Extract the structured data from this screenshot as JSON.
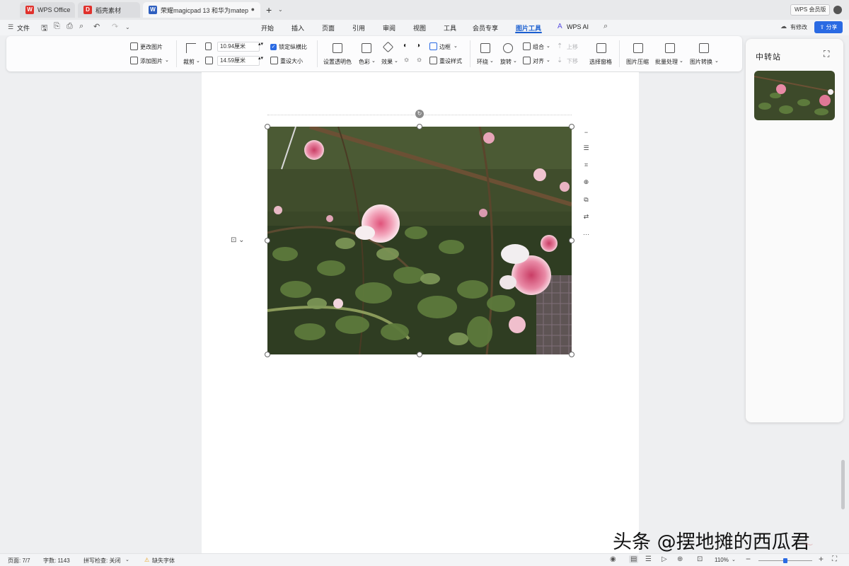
{
  "tabs": [
    {
      "label": "WPS Office",
      "icon": "wps-logo-icon",
      "color": "#e0312c"
    },
    {
      "label": "稻壳素材",
      "icon": "daoke-logo-icon",
      "color": "#e0312c"
    },
    {
      "label": "荣耀magicpad 13 和华为matep",
      "icon": "word-doc-icon",
      "color": "#2f5fbf",
      "active": true
    }
  ],
  "member_badge": "WPS 会员版",
  "menu": {
    "file": "文件",
    "items": [
      "开始",
      "插入",
      "页面",
      "引用",
      "审阅",
      "视图",
      "工具",
      "会员专享",
      "图片工具",
      "WPS AI"
    ],
    "active": "图片工具",
    "modified": "有修改",
    "share": "分享"
  },
  "ribbon": {
    "change_image": "更改图片",
    "add_image": "添加图片",
    "crop": "裁剪",
    "width": "10.94厘米",
    "height": "14.59厘米",
    "lock_ratio": "锁定纵横比",
    "reset_size": "重设大小",
    "set_transparent": "设置透明色",
    "color": "色彩",
    "effect": "效果",
    "border": "边框",
    "reset_style": "重设样式",
    "wrap": "环绕",
    "rotate": "旋转",
    "group": "组合",
    "align": "对齐",
    "bring_forward": "上移",
    "send_backward": "下移",
    "selection_pane": "选择窗格",
    "compress": "图片压缩",
    "batch": "批量处理",
    "convert": "图片转换"
  },
  "clipboard": {
    "title": "中转站"
  },
  "status": {
    "page": "页面: 7/7",
    "words": "字数: 1143",
    "spell": "拼写检查: 关闭",
    "missing_font": "缺失字体",
    "zoom": "110%",
    "zoom_fraction": 0.5
  },
  "watermark": "头条 @摆地摊的西瓜君",
  "accent_color": "#2a6ae3"
}
